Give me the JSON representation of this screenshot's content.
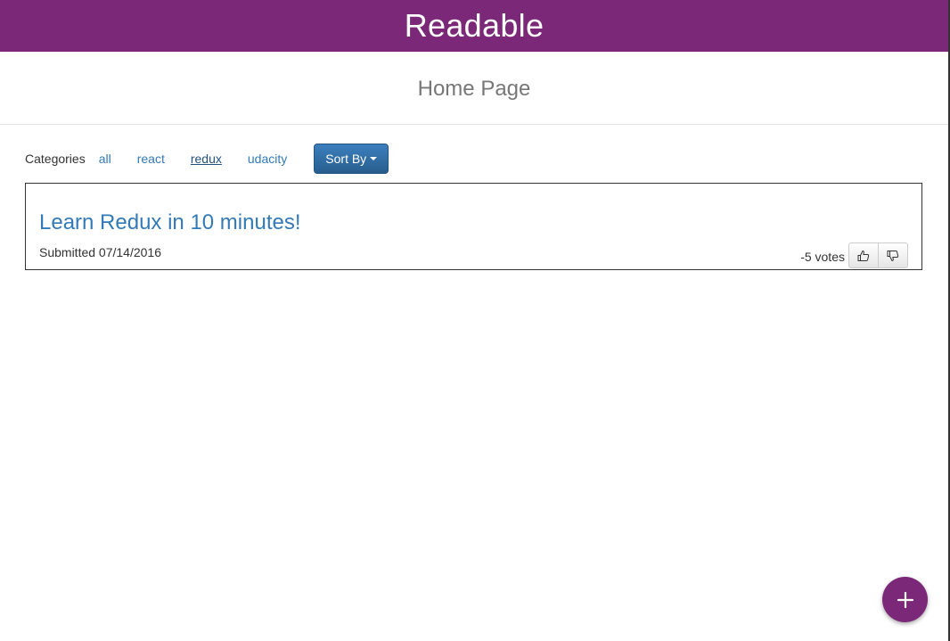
{
  "app": {
    "title": "Readable",
    "header_color": "#7b2878"
  },
  "page": {
    "title": "Home Page"
  },
  "categories": {
    "label": "Categories",
    "items": [
      {
        "label": "all",
        "active": false
      },
      {
        "label": "react",
        "active": false
      },
      {
        "label": "redux",
        "active": true
      },
      {
        "label": "udacity",
        "active": false
      }
    ]
  },
  "sort": {
    "label": "Sort By",
    "icon": "caret-down-icon",
    "color": "#337ab7"
  },
  "posts": [
    {
      "title": "Learn Redux in 10 minutes!",
      "submitted": "Submitted 07/14/2016",
      "votes": "-5 votes",
      "upvote_icon": "thumbs-up-icon",
      "downvote_icon": "thumbs-down-icon"
    }
  ],
  "fab": {
    "icon": "plus-icon",
    "color": "#7b2878"
  }
}
